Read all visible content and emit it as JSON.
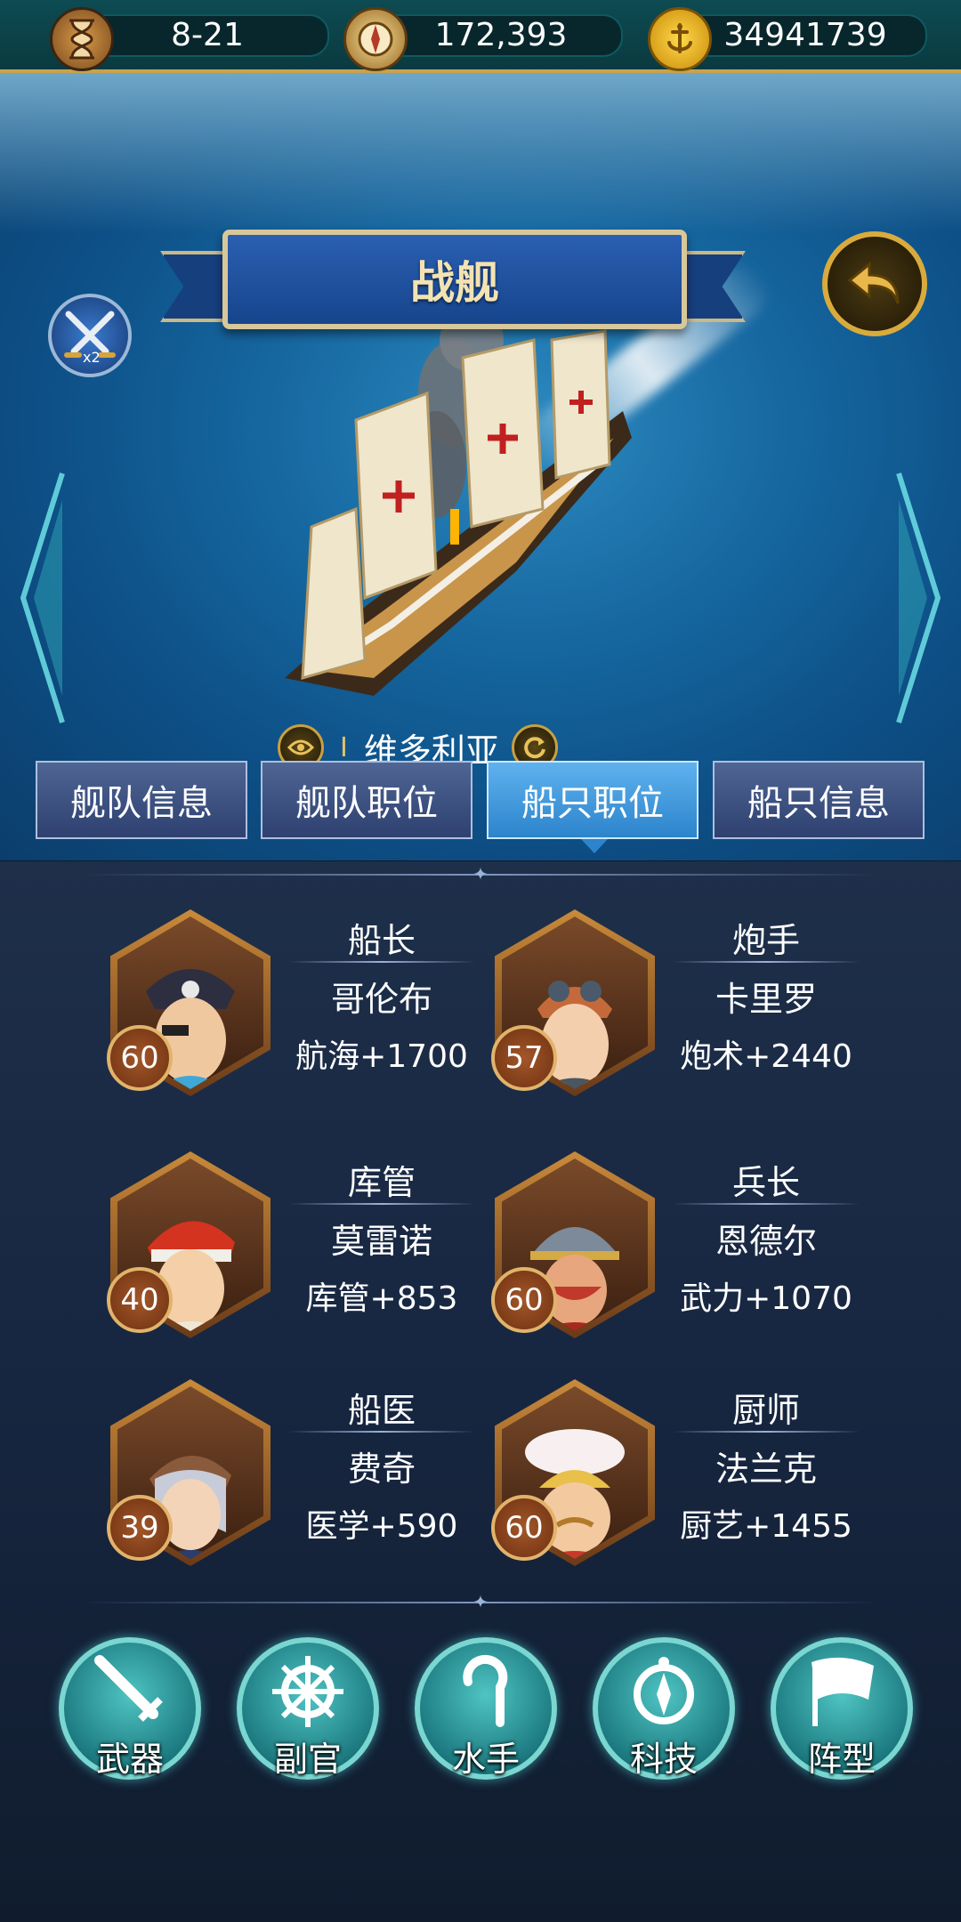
{
  "resources": {
    "time": "8-21",
    "compass": "172,393",
    "gold": "34941739"
  },
  "scene": {
    "banner_title": "战舰",
    "ship_level": "I",
    "ship_name": "维多利亚",
    "battle_badge_count": "x2"
  },
  "tabs": [
    {
      "label": "舰队信息",
      "active": false
    },
    {
      "label": "舰队职位",
      "active": false
    },
    {
      "label": "船只职位",
      "active": true
    },
    {
      "label": "船只信息",
      "active": false
    }
  ],
  "crew": [
    {
      "role": "船长",
      "name": "哥伦布",
      "stat": "航海+1700",
      "level": "60"
    },
    {
      "role": "炮手",
      "name": "卡里罗",
      "stat": "炮术+2440",
      "level": "57"
    },
    {
      "role": "库管",
      "name": "莫雷诺",
      "stat": "库管+853",
      "level": "40"
    },
    {
      "role": "兵长",
      "name": "恩德尔",
      "stat": "武力+1070",
      "level": "60"
    },
    {
      "role": "船医",
      "name": "费奇",
      "stat": "医学+590",
      "level": "39"
    },
    {
      "role": "厨师",
      "name": "法兰克",
      "stat": "厨艺+1455",
      "level": "60"
    }
  ],
  "bottom_buttons": [
    {
      "label": "武器",
      "icon": "sword-icon"
    },
    {
      "label": "副官",
      "icon": "helm-wheel-icon"
    },
    {
      "label": "水手",
      "icon": "hook-icon"
    },
    {
      "label": "科技",
      "icon": "compass-icon"
    },
    {
      "label": "阵型",
      "icon": "flag-icon"
    }
  ]
}
